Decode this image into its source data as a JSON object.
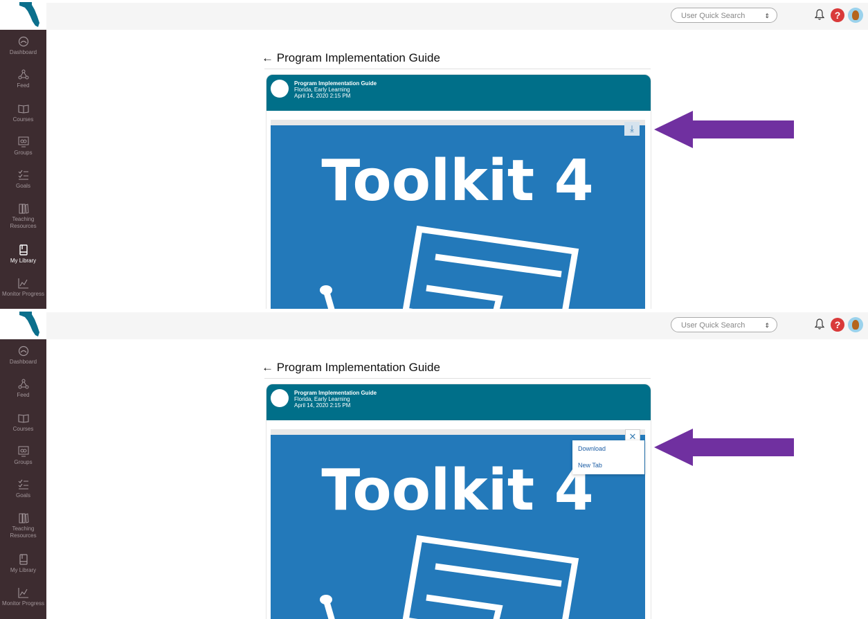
{
  "topbar": {
    "search_placeholder": "User Quick Search",
    "select_arrows": "⇕"
  },
  "sidebar": {
    "items": [
      {
        "label": "Dashboard",
        "icon": "dashboard-gauge-icon"
      },
      {
        "label": "Feed",
        "icon": "feed-network-icon"
      },
      {
        "label": "Courses",
        "icon": "courses-book-icon"
      },
      {
        "label": "Groups",
        "icon": "groups-people-icon"
      },
      {
        "label": "Goals",
        "icon": "goals-checklist-icon"
      },
      {
        "label": "Teaching Resources",
        "icon": "teaching-resources-books-icon"
      },
      {
        "label": "My Library",
        "icon": "my-library-icon"
      },
      {
        "label": "Monitor Progress",
        "icon": "monitor-progress-chart-icon"
      }
    ]
  },
  "page": {
    "back_arrow": "←",
    "title": "Program Implementation Guide"
  },
  "post": {
    "title": "Program Implementation Guide",
    "subtitle": "Florida, Early Learning",
    "date": "April 14, 2020 2:15 PM"
  },
  "document": {
    "headline": "Toolkit 4",
    "background_color": "#2379ba"
  },
  "viewer": {
    "download_glyph": "⤓",
    "close_glyph": "✕"
  },
  "menu": {
    "items": [
      "Download",
      "New Tab"
    ]
  },
  "colors": {
    "sidebar_bg": "#3d2c30",
    "header_teal": "#006f89",
    "annotation_arrow": "#7030a0",
    "help_red": "#d93a3a"
  }
}
